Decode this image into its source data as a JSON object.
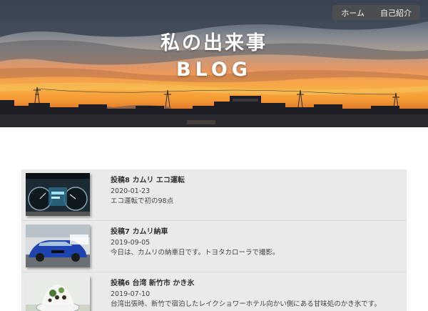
{
  "nav": {
    "home": "ホーム",
    "about": "自己紹介"
  },
  "hero": {
    "title": "私の出来事",
    "subtitle": "BLOG"
  },
  "posts": [
    {
      "title": "投稿8 カムリ エコ運転",
      "date": "2020-01-23",
      "desc": "エコ運転で初の98点",
      "thumb_icon": "dashboard-photo"
    },
    {
      "title": "投稿7 カムリ納車",
      "date": "2019-09-05",
      "desc": "今日は、カムリの納車日です。トヨタカローラで撮影。",
      "thumb_icon": "blue-car-photo"
    },
    {
      "title": "投稿6 台湾 新竹市 かき氷",
      "date": "2019-07-10",
      "desc": "台湾出張時、新竹で宿泊したレイクショワーホテル向かい側にある甘味処のかき氷です。",
      "thumb_icon": "shaved-ice-photo"
    }
  ]
}
